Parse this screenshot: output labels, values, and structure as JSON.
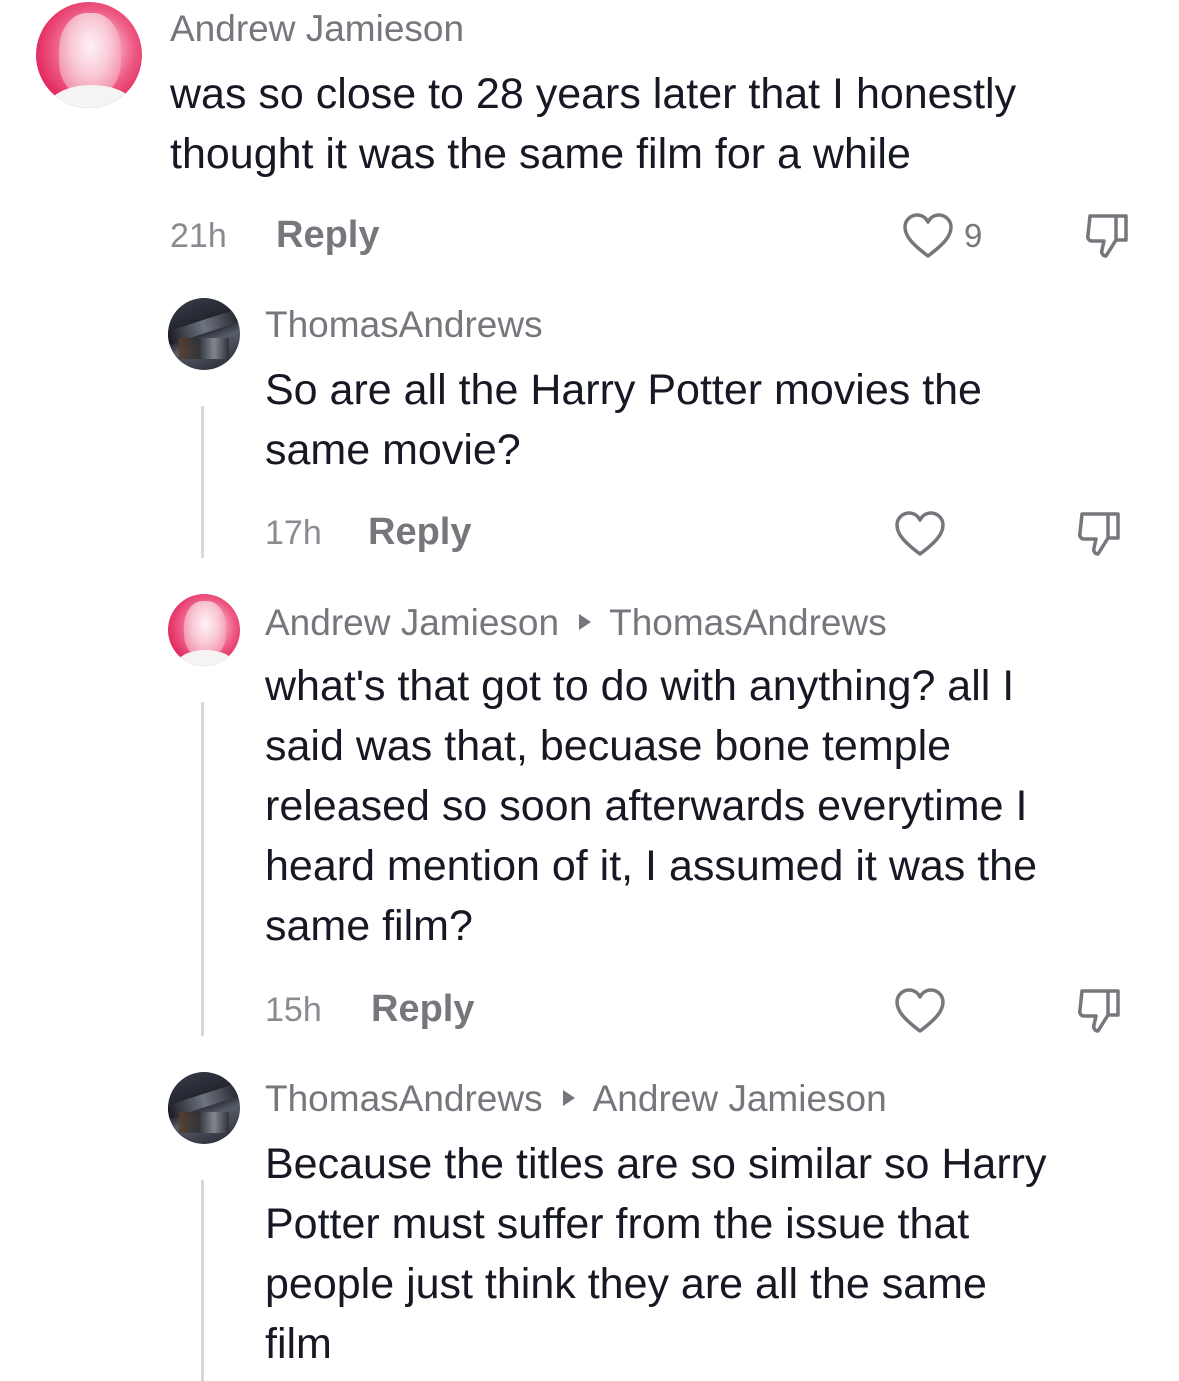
{
  "comments": [
    {
      "author": "Andrew Jamieson",
      "reply_to": "",
      "text": "was so close to 28 years later that I honestly\nthought it was the same film for a while",
      "time": "21h",
      "reply_label": "Reply",
      "likes": "9",
      "avatar": "pink-face-avatar"
    },
    {
      "author": "ThomasAndrews",
      "reply_to": "",
      "text": "So are all the Harry Potter movies the\nsame movie?",
      "time": "17h",
      "reply_label": "Reply",
      "likes": "",
      "avatar": "dark-photo-avatar"
    },
    {
      "author": "Andrew Jamieson",
      "reply_to": "ThomasAndrews",
      "text": "what's that got to do with anything? all I\nsaid was that, becuase bone temple\nreleased so soon afterwards everytime I\nheard mention of it, I assumed it was the\nsame film?",
      "time": "15h",
      "reply_label": "Reply",
      "likes": "",
      "avatar": "pink-face-avatar"
    },
    {
      "author": "ThomasAndrews",
      "reply_to": "Andrew Jamieson",
      "text": "Because the titles are so similar so Harry\nPotter must suffer from the issue that\npeople just think they are all the same\nfilm",
      "time": "",
      "reply_label": "",
      "likes": "",
      "avatar": "dark-photo-avatar"
    }
  ],
  "icons": {
    "like": "heart-outline-icon",
    "dislike": "thumbs-down-icon",
    "reply_arrow": "triangle-right-icon"
  },
  "colors": {
    "text": "#161823",
    "secondary": "#76777d",
    "thread_line": "#d8d8db",
    "background": "#ffffff"
  }
}
